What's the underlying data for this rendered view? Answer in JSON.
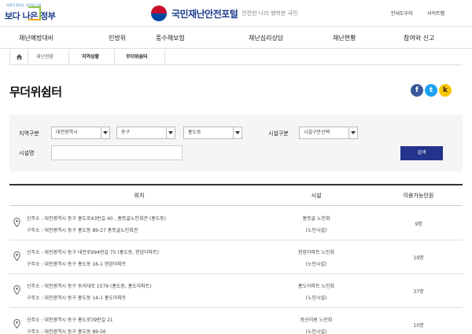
{
  "header": {
    "gov_logo_small": "다같이 잘사는 국민의 나라",
    "gov_logo": "보다 나은 정부",
    "site_name": "국민재난안전포털",
    "slogan": "안전한 나라 행복한 국민",
    "utils": [
      "안내도우미",
      "사이트맵"
    ]
  },
  "gnb": [
    "재난예방대비",
    "민방위",
    "풍수해보험",
    "재난심리상담",
    "재난현황",
    "참여와 신고"
  ],
  "breadcrumb": [
    "재난현황",
    "지역상황",
    "무더위쉼터"
  ],
  "page_title": "무더위쉼터",
  "sns": {
    "facebook": "f",
    "twitter": "t",
    "kakao": "k"
  },
  "search": {
    "region_label": "지역구분",
    "region": [
      "대전광역시",
      "동구",
      "홍도동"
    ],
    "facility_label": "시설구분",
    "facility_select": "시설구분선택",
    "name_label": "시설명",
    "name_value": "",
    "search_btn": "검색"
  },
  "table": {
    "headers": [
      "위치",
      "시설",
      "이용가능인원"
    ],
    "rows": [
      {
        "addr_new": "신주소 : 대전광역시 동구 홍도로43번길 40 , 홍뜻골노인회관 (홍도동)",
        "addr_old": "구주소 : 대전광역시 동구 홍도동 89-27 홍뜻골노인회관",
        "name": "홍뜻골 노인회",
        "type": "(노인시설)",
        "capacity": "9명"
      },
      {
        "addr_new": "신주소 : 대전광역시 동구 대전로994번길 75 (홍도동, 현암아파트)",
        "addr_old": "구주소 : 대전광역시 동구 홍도동 16-1 현암아파트",
        "name": "현암아파트 노인회",
        "type": "(노인시설)",
        "capacity": "19명"
      },
      {
        "addr_new": "신주소 : 대전광역시 동구 동서대로 1579 (홍도동, 홍도아파트)",
        "addr_old": "구주소 : 대전광역시 동구 홍도동 14-1 홍도아파트",
        "name": "홍도아파트 노인회",
        "type": "(노인시설)",
        "capacity": "37명"
      },
      {
        "addr_new": "신주소 : 대전광역시 동구 홍도로39번길 21",
        "addr_old": "구주소 : 대전광역시 동구 홍도동 89-56",
        "name": "동산리원 노인회",
        "type": "(노인시설)",
        "capacity": "10명"
      }
    ]
  }
}
